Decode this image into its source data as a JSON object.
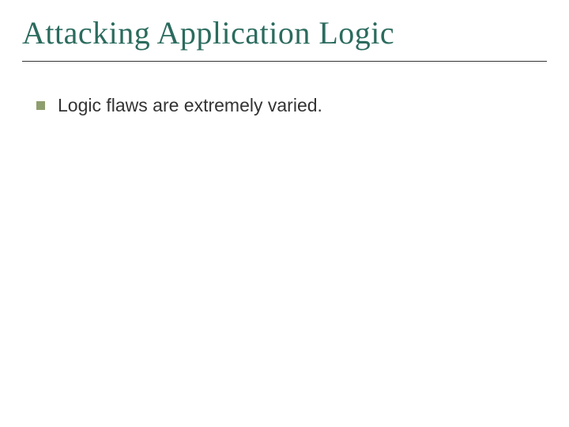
{
  "title": "Attacking Application Logic",
  "bullets": [
    {
      "text": "Logic flaws are extremely varied."
    }
  ]
}
